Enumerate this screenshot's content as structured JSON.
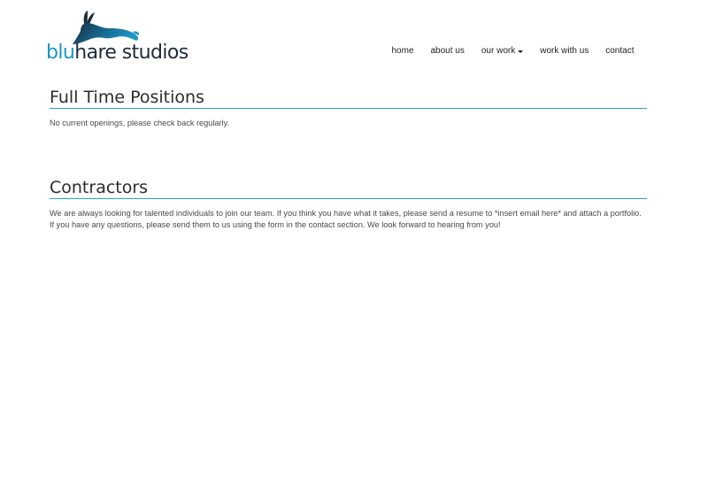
{
  "brand": {
    "wordmark_accent": "blu",
    "wordmark_rest": "hare studios",
    "logo_icon": "hare-icon",
    "accent_color": "#1b97c4",
    "dark_color": "#1d2b3a"
  },
  "nav": {
    "home": "home",
    "about": "about us",
    "work": "our work",
    "work_with_us": "work with us",
    "contact": "contact"
  },
  "sections": {
    "fulltime": {
      "title": "Full Time Positions",
      "body": "No current openings, please check back regularly."
    },
    "contractors": {
      "title": "Contractors",
      "body": "We are always looking for talented individuals to join our team. If you think you have what it takes, please send a resume to *insert email here* and attach a portfolio. If you have any questions, please send them to us using the form in the contact section. We look forward to hearing from you!"
    }
  },
  "colors": {
    "rule": "#2aa5cf",
    "heading": "#2c2c2c",
    "body_text": "#4a4a4a"
  }
}
